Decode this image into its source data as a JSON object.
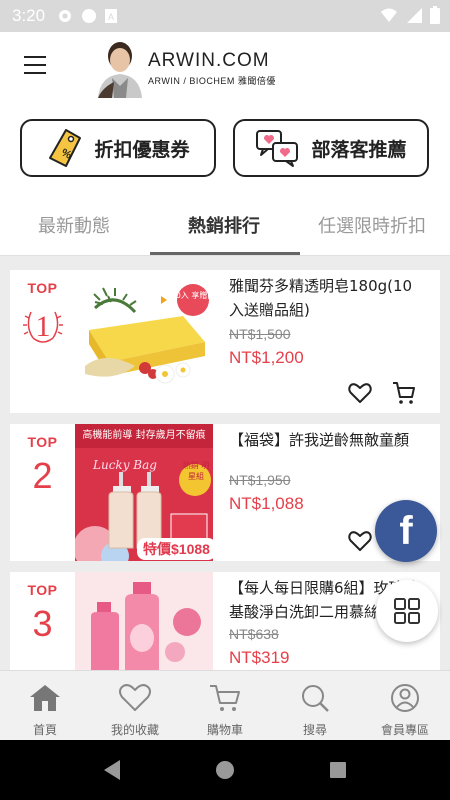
{
  "status": {
    "time": "3:20"
  },
  "header": {
    "logo_title": "ARWIN.COM",
    "logo_sub": "ARWIN / BIOCHEM 雅聞倍優"
  },
  "promo": {
    "coupon_label": "折扣優惠券",
    "blog_label": "部落客推薦"
  },
  "tabs": [
    {
      "label": "最新動態"
    },
    {
      "label": "熱銷排行"
    },
    {
      "label": "任選限時折扣"
    }
  ],
  "products": [
    {
      "rank_label": "TOP",
      "rank": "1",
      "title": "雅聞芬多精透明皂180g(10入送贈品組)",
      "badge": "10入 享贈品",
      "old_price": "NT$1,500",
      "price": "NT$1,200"
    },
    {
      "rank_label": "TOP",
      "rank": "2",
      "title": "【福袋】許我逆齡無敵童顏",
      "banner": "高機能前導 封存歲月不留痕",
      "lucky": "Lucky Bag",
      "badge": "熱銷 明星組",
      "special": "特價$1088",
      "old_price": "NT$1,950",
      "price": "NT$1,088"
    },
    {
      "rank_label": "TOP",
      "rank": "3",
      "title": "【每人每日限購6組】玫瑰胺基酸淨白洗卸二用慕絲",
      "old_price": "NT$638",
      "price": "NT$319"
    }
  ],
  "bottom_nav": [
    {
      "label": "首頁",
      "icon": "home-icon"
    },
    {
      "label": "我的收藏",
      "icon": "heart-icon"
    },
    {
      "label": "購物車",
      "icon": "cart-icon"
    },
    {
      "label": "搜尋",
      "icon": "search-icon"
    },
    {
      "label": "會員專區",
      "icon": "user-icon"
    }
  ],
  "colors": {
    "accent": "#e5404a",
    "facebook": "#3b5998"
  }
}
